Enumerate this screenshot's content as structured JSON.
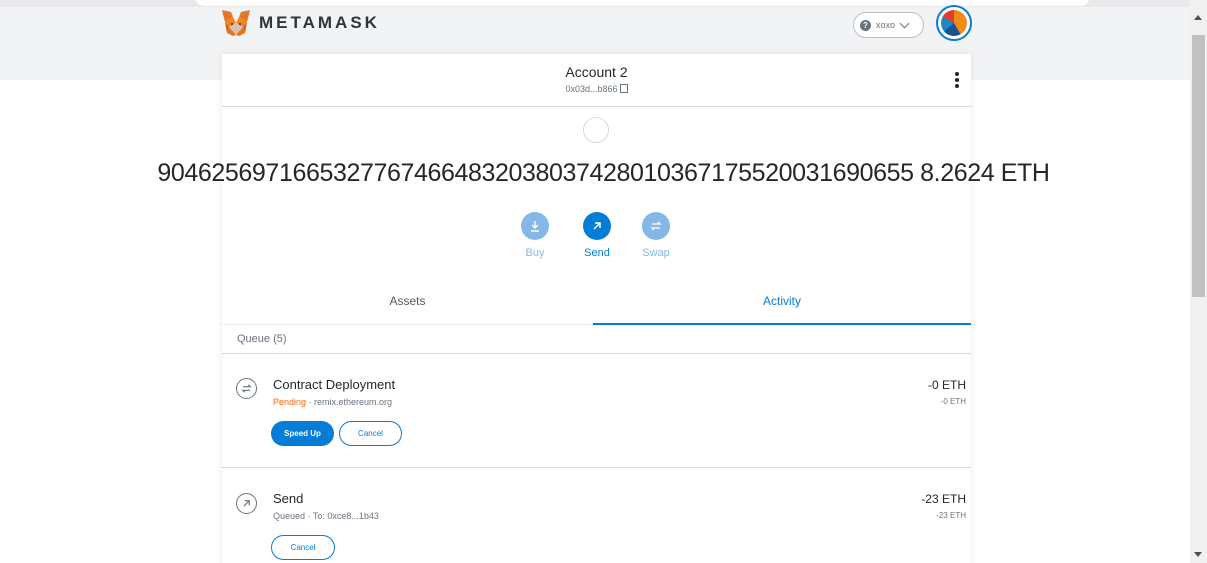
{
  "app": {
    "name": "METAMASK"
  },
  "network": {
    "label": "xoxo"
  },
  "account": {
    "name": "Account 2",
    "address": "0x03d...b866"
  },
  "balance": {
    "text": "90462569716653277674664832038037428010367175520031690655 8.2624 ETH"
  },
  "actions": [
    {
      "label": "Buy",
      "icon": "download-icon",
      "enabled": false
    },
    {
      "label": "Send",
      "icon": "arrow-up-right-icon",
      "enabled": true
    },
    {
      "label": "Swap",
      "icon": "swap-icon",
      "enabled": false
    }
  ],
  "tabs": {
    "assets": "Assets",
    "activity": "Activity"
  },
  "queue": {
    "label": "Queue (5)"
  },
  "transactions": [
    {
      "title": "Contract Deployment",
      "status": "Pending",
      "separator": " · ",
      "detail": "remix.ethereum.org",
      "amount": "-0 ETH",
      "amount_secondary": "-0 ETH",
      "speed_up_label": "Speed Up",
      "cancel_label": "Cancel"
    },
    {
      "title": "Send",
      "status": "Queued",
      "separator": " · ",
      "detail": "To: 0xce8...1b43",
      "amount": "-23 ETH",
      "amount_secondary": "-23 ETH",
      "cancel_label": "Cancel"
    }
  ],
  "colors": {
    "accent": "#037dd6",
    "pending": "#f66a0a",
    "disabled_action": "#85b8e6"
  }
}
